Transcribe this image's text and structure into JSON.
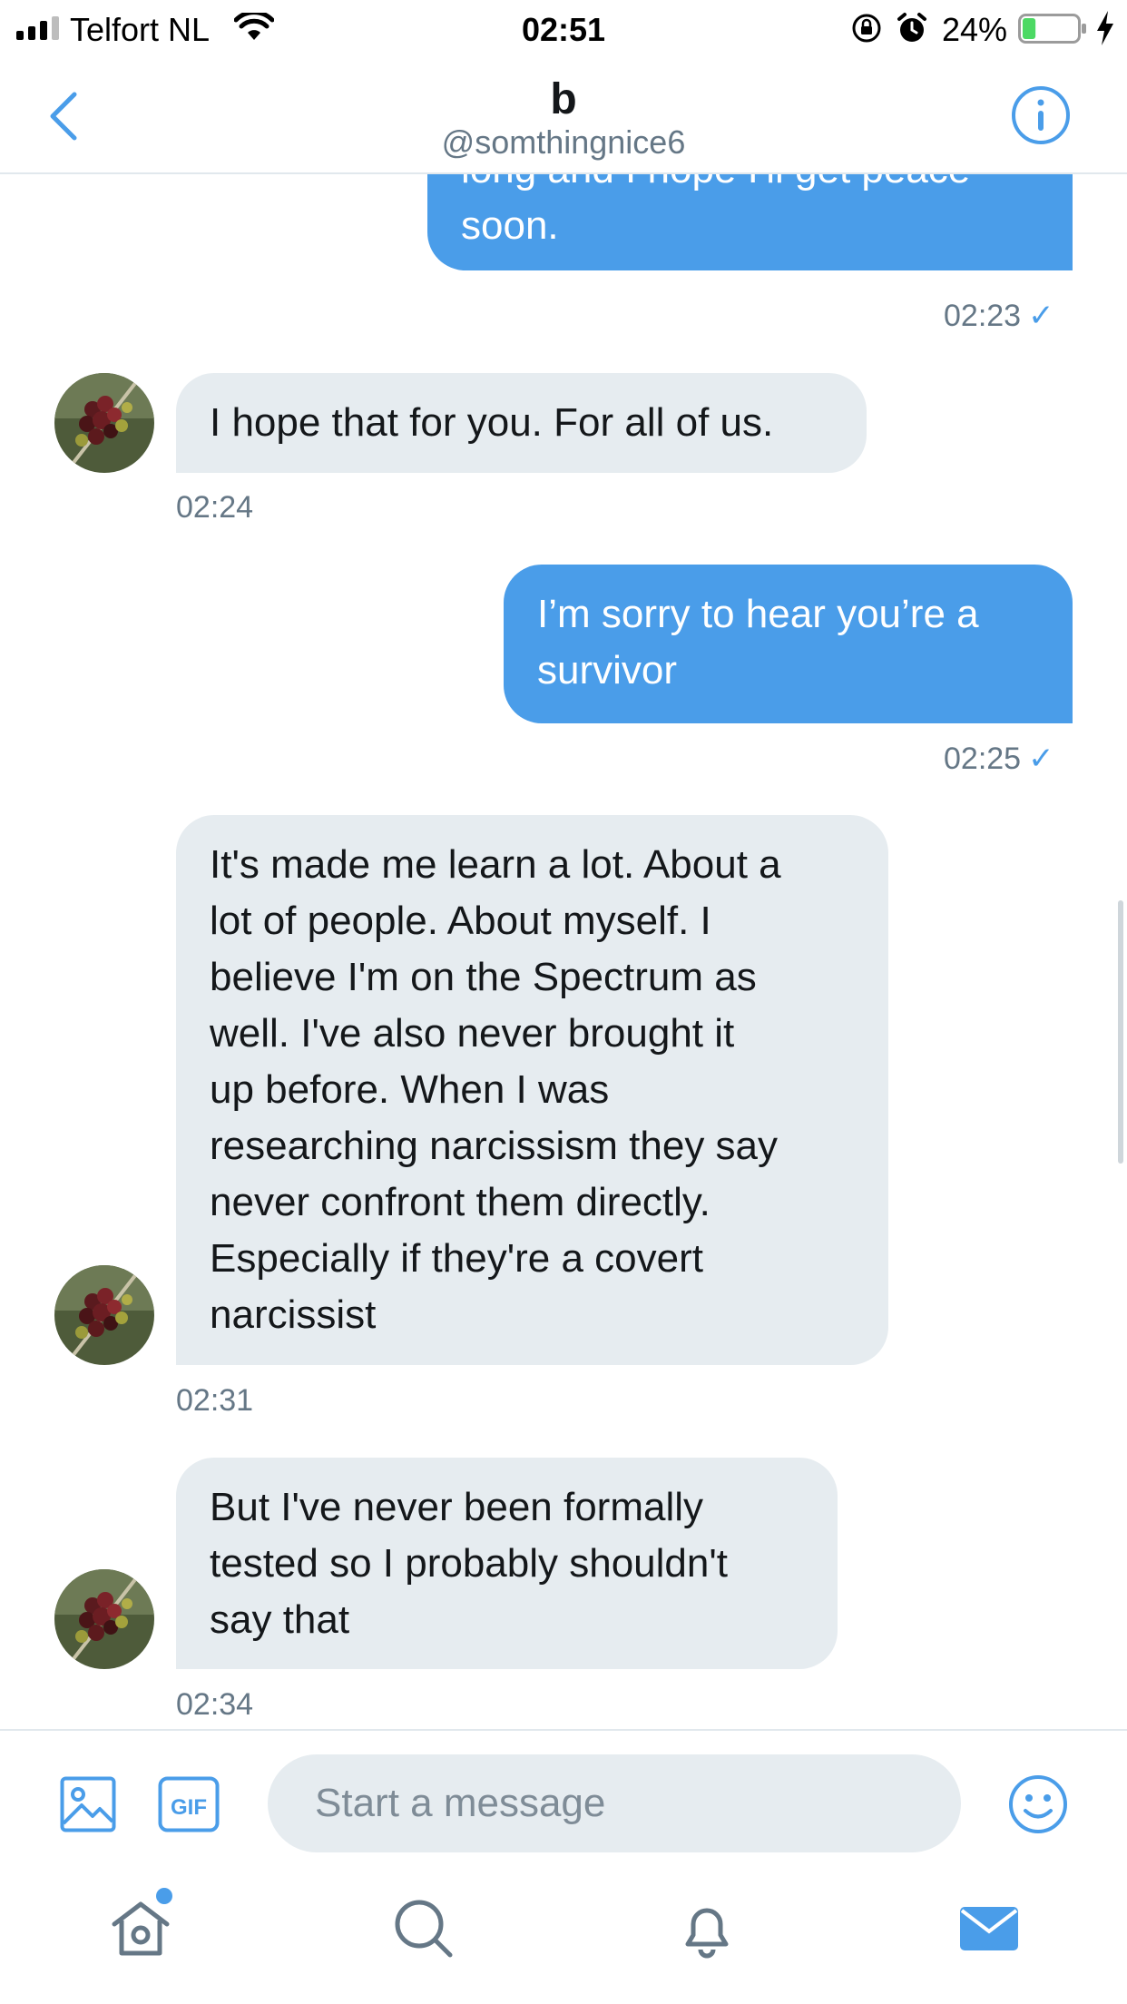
{
  "status_bar": {
    "carrier": "Telfort NL",
    "time": "02:51",
    "battery": "24%",
    "battery_level": 0.24
  },
  "header": {
    "name": "b",
    "handle": "@somthingnice6"
  },
  "messages": [
    {
      "sender": "me",
      "lines": [
        "long and I hope I'll get peace",
        "soon."
      ],
      "time": "02:23",
      "read": true
    },
    {
      "sender": "them",
      "lines": [
        "I hope that for you. For all of us."
      ],
      "time": "02:24"
    },
    {
      "sender": "me",
      "lines": [
        "I’m sorry to hear you’re a",
        "survivor"
      ],
      "time": "02:25",
      "read": true
    },
    {
      "sender": "them",
      "lines": [
        "It's made me learn a lot. About a",
        "lot of people. About myself. I",
        "believe I'm on the Spectrum as",
        "well. I've also never brought it",
        "up before. When I was",
        "researching narcissism they say",
        "never confront them directly.",
        "Especially if they're a covert",
        "narcissist"
      ],
      "time": "02:31"
    },
    {
      "sender": "them",
      "lines": [
        "But I've never been formally",
        "tested so I probably shouldn't",
        "say that"
      ],
      "time": "02:34"
    }
  ],
  "composer": {
    "placeholder": "Start a message",
    "gif_label": "GIF"
  },
  "icons": {
    "back": "chevron-left-icon",
    "info": "info-icon",
    "media": "image-icon",
    "gif": "gif-icon",
    "emoji": "emoji-icon",
    "home": "home-icon",
    "search": "search-icon",
    "notifications": "bell-icon",
    "messages": "envelope-icon"
  },
  "colors": {
    "accent": "#4a9de9",
    "sent_bubble": "#4a9de9",
    "received_bubble": "#e6ecf0",
    "battery_fill": "#4cd964"
  }
}
